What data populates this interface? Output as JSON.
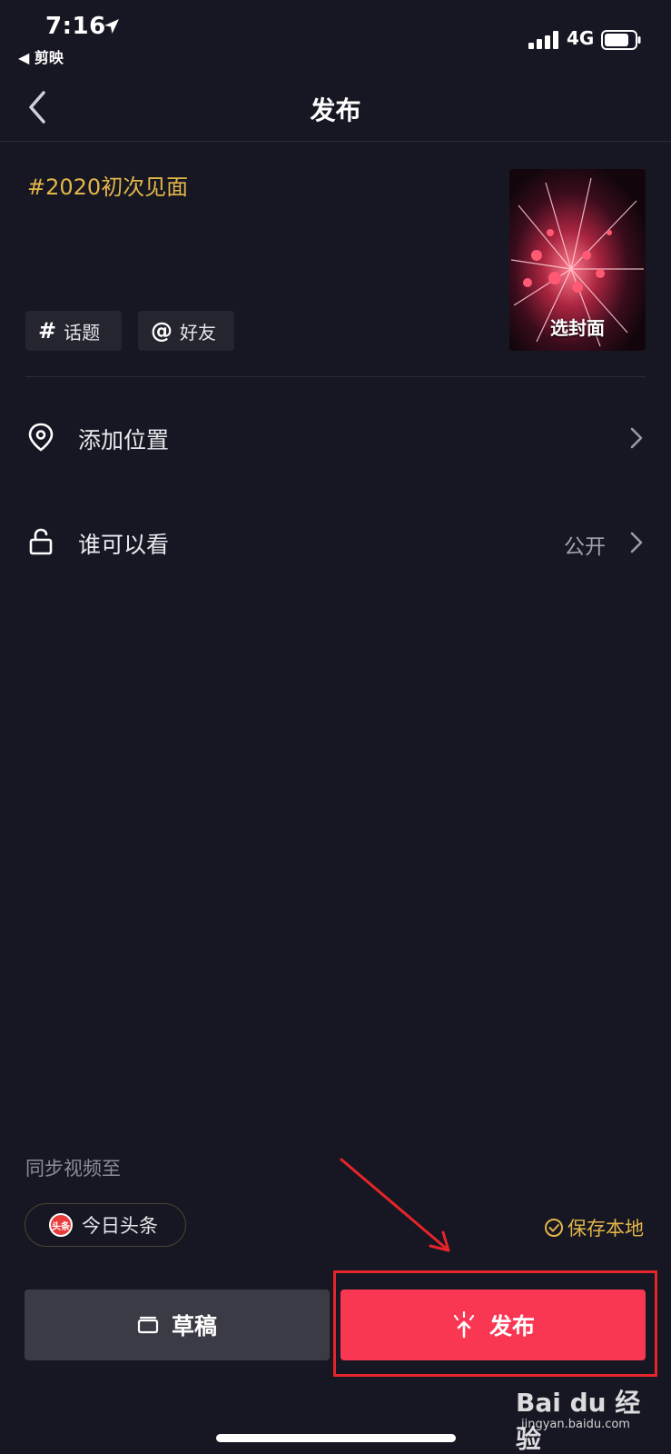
{
  "status_bar": {
    "time": "7:16",
    "back_app": "◀ 剪映",
    "network": "4G"
  },
  "header": {
    "title": "发布"
  },
  "compose": {
    "caption": "#2020初次见面",
    "cover_label": "选封面",
    "chips": [
      {
        "icon": "#",
        "label": "话题"
      },
      {
        "icon": "@",
        "label": "好友"
      }
    ]
  },
  "rows": {
    "location": {
      "label": "添加位置"
    },
    "privacy": {
      "label": "谁可以看",
      "value": "公开"
    }
  },
  "sync": {
    "title": "同步视频至",
    "toutiao_logo": "头条",
    "toutiao_label": "今日头条",
    "save_local": "保存本地"
  },
  "actions": {
    "draft_label": "草稿",
    "publish_label": "发布"
  },
  "watermark": {
    "brand": "Bai du 经验",
    "url": "jingyan.baidu.com"
  },
  "colors": {
    "background": "#161722",
    "accent_gold": "#e3b54a",
    "publish_red": "#fa3753",
    "annotation_red": "#e5252a"
  }
}
